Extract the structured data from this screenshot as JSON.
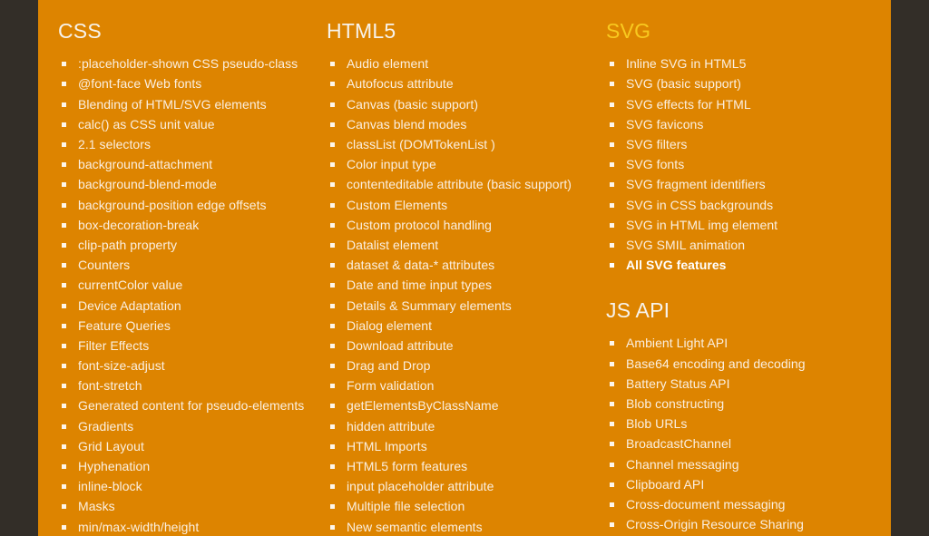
{
  "theme": {
    "page_background": "#DD8400",
    "chrome_background": "#332E28",
    "text_color": "#FBEFE0",
    "heading_color": "#F7F3EC",
    "accent_heading_color": "#F8C91F",
    "bullet_color": "#FDF6EC"
  },
  "columns": {
    "css": {
      "heading": "CSS",
      "items": [
        ":placeholder-shown CSS pseudo-class",
        "@font-face Web fonts",
        "Blending of HTML/SVG elements",
        "calc() as CSS unit value",
        "2.1 selectors",
        "background-attachment",
        "background-blend-mode",
        "background-position edge offsets",
        "box-decoration-break",
        "clip-path property",
        "Counters",
        "currentColor value",
        "Device Adaptation",
        "Feature Queries",
        "Filter Effects",
        "font-size-adjust",
        "font-stretch",
        "Generated content for pseudo-elements",
        "Gradients",
        "Grid Layout",
        "Hyphenation",
        "inline-block",
        "Masks",
        "min/max-width/height"
      ]
    },
    "html5": {
      "heading": "HTML5",
      "items": [
        "Audio element",
        "Autofocus attribute",
        "Canvas (basic support)",
        "Canvas blend modes",
        "classList (DOMTokenList )",
        "Color input type",
        "contenteditable attribute (basic support)",
        "Custom Elements",
        "Custom protocol handling",
        "Datalist element",
        "dataset & data-* attributes",
        "Date and time input types",
        "Details & Summary elements",
        "Dialog element",
        "Download attribute",
        "Drag and Drop",
        "Form validation",
        "getElementsByClassName",
        "hidden attribute",
        "HTML Imports",
        "HTML5 form features",
        "input placeholder attribute",
        "Multiple file selection",
        "New semantic elements"
      ]
    },
    "svg": {
      "heading": "SVG",
      "items": [
        {
          "label": "Inline SVG in HTML5",
          "strong": false
        },
        {
          "label": "SVG (basic support)",
          "strong": false
        },
        {
          "label": "SVG effects for HTML",
          "strong": false
        },
        {
          "label": "SVG favicons",
          "strong": false
        },
        {
          "label": "SVG filters",
          "strong": false
        },
        {
          "label": "SVG fonts",
          "strong": false
        },
        {
          "label": "SVG fragment identifiers",
          "strong": false
        },
        {
          "label": "SVG in CSS backgrounds",
          "strong": false
        },
        {
          "label": "SVG in HTML img element",
          "strong": false
        },
        {
          "label": "SVG SMIL animation",
          "strong": false
        },
        {
          "label": "All SVG features",
          "strong": true
        }
      ]
    },
    "js_api": {
      "heading": "JS API",
      "items": [
        "Ambient Light API",
        "Base64 encoding and decoding",
        "Battery Status API",
        "Blob constructing",
        "Blob URLs",
        "BroadcastChannel",
        "Channel messaging",
        "Clipboard API",
        "Cross-document messaging",
        "Cross-Origin Resource Sharing"
      ]
    }
  }
}
